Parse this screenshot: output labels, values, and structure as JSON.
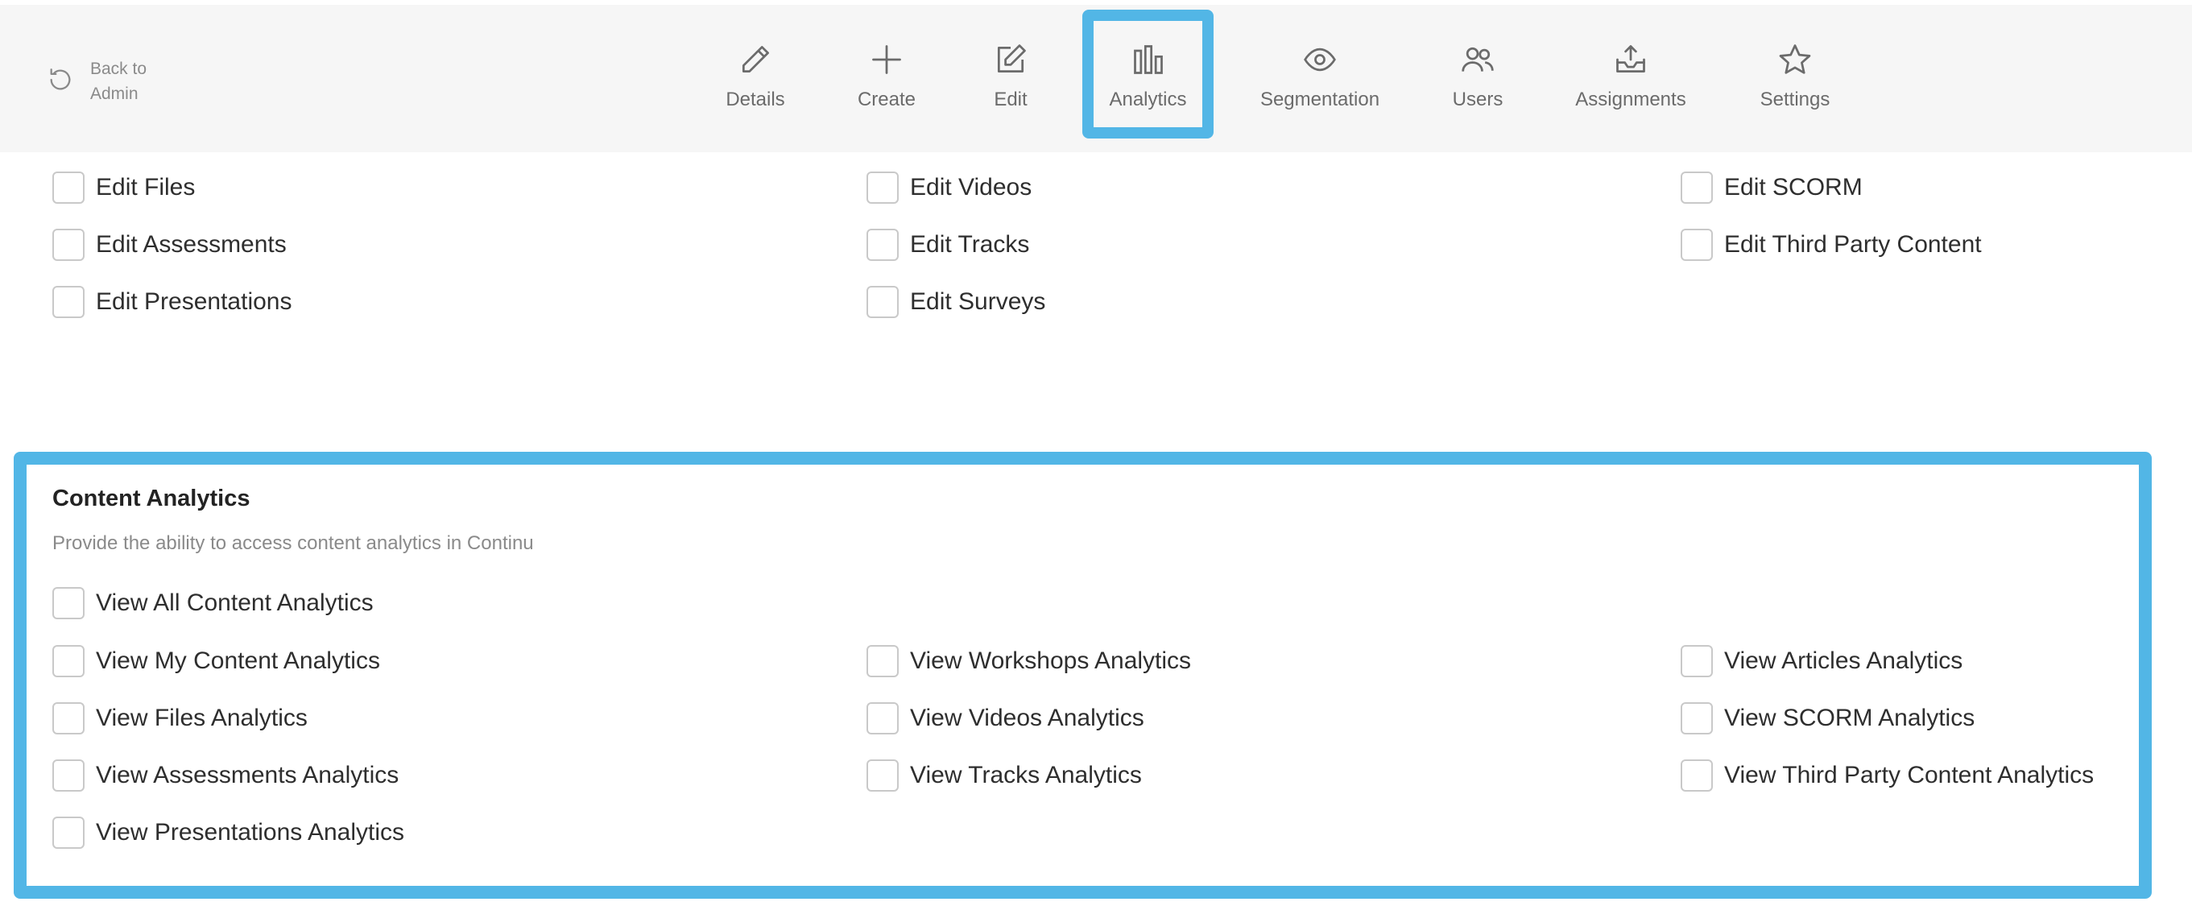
{
  "back": {
    "line1": "Back to",
    "line2": "Admin"
  },
  "nav": {
    "items": [
      {
        "label": "Details",
        "icon": "pencil-icon"
      },
      {
        "label": "Create",
        "icon": "plus-icon"
      },
      {
        "label": "Edit",
        "icon": "edit-icon"
      },
      {
        "label": "Analytics",
        "icon": "bar-chart-icon",
        "active": true
      },
      {
        "label": "Segmentation",
        "icon": "eye-icon"
      },
      {
        "label": "Users",
        "icon": "users-icon"
      },
      {
        "label": "Assignments",
        "icon": "inbox-upload-icon"
      },
      {
        "label": "Settings",
        "icon": "star-icon"
      }
    ]
  },
  "edit_permissions": {
    "items": [
      {
        "label": "Edit Files",
        "checked": false
      },
      {
        "label": "Edit Videos",
        "checked": false
      },
      {
        "label": "Edit SCORM",
        "checked": false
      },
      {
        "label": "Edit Assessments",
        "checked": false
      },
      {
        "label": "Edit Tracks",
        "checked": false
      },
      {
        "label": "Edit Third Party Content",
        "checked": false
      },
      {
        "label": "Edit Presentations",
        "checked": false
      },
      {
        "label": "Edit Surveys",
        "checked": false
      }
    ]
  },
  "content_analytics": {
    "title": "Content Analytics",
    "description": "Provide the ability to access content analytics in Continu",
    "items": [
      {
        "label": "View All Content Analytics",
        "checked": false
      },
      {
        "label": "View My Content Analytics",
        "checked": false
      },
      {
        "label": "View Workshops Analytics",
        "checked": false
      },
      {
        "label": "View Articles Analytics",
        "checked": false
      },
      {
        "label": "View Files Analytics",
        "checked": false
      },
      {
        "label": "View Videos Analytics",
        "checked": false
      },
      {
        "label": "View SCORM Analytics",
        "checked": false
      },
      {
        "label": "View Assessments Analytics",
        "checked": false
      },
      {
        "label": "View Tracks Analytics",
        "checked": false
      },
      {
        "label": "View Third Party Content Analytics",
        "checked": false
      },
      {
        "label": "View Presentations Analytics",
        "checked": false
      }
    ]
  },
  "colors": {
    "highlight": "#52b6e6",
    "topbar_bg": "#f6f6f6",
    "icon": "#6b6b6b"
  }
}
